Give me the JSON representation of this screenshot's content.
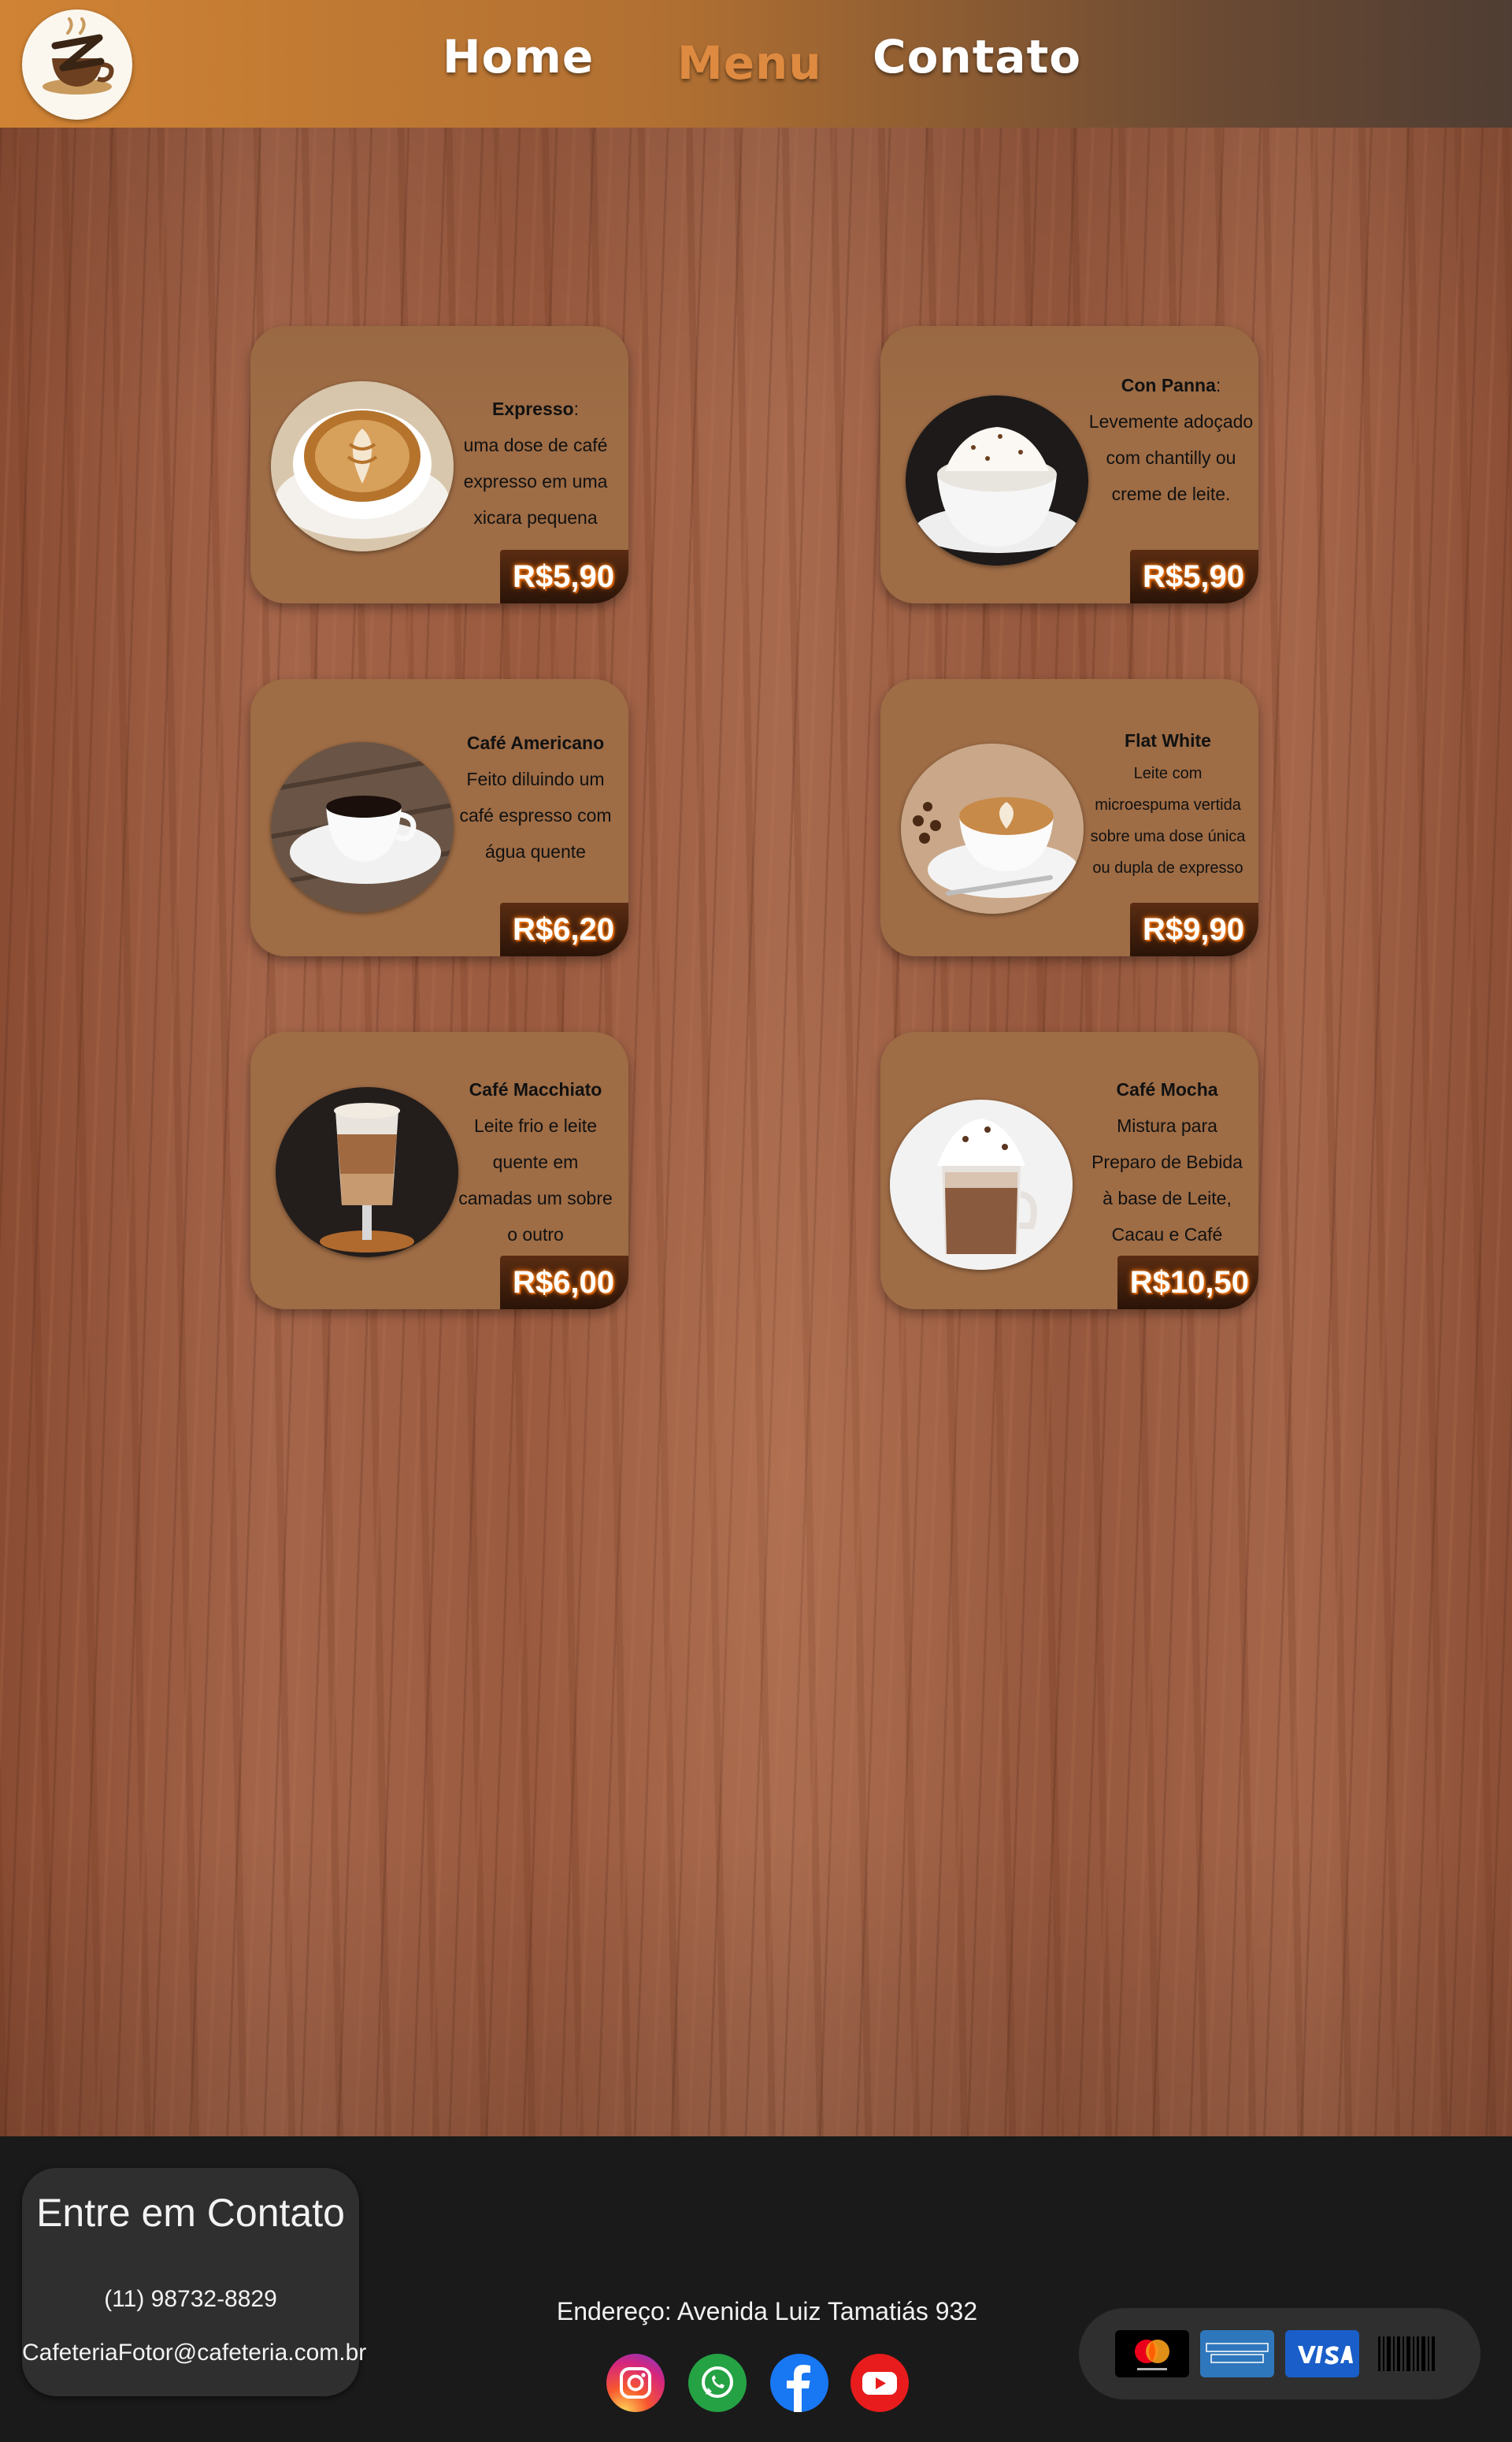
{
  "header": {
    "logo_icon": "coffee-cup-logo-icon",
    "nav": [
      {
        "label": "Home"
      },
      {
        "label": "Menu",
        "active": true
      },
      {
        "label": "Contato"
      }
    ],
    "colors": {
      "active_nav": "#de8a40",
      "nav": "#ffffff"
    }
  },
  "menu": {
    "items": [
      {
        "name": "Expresso",
        "suffix": ":",
        "description": "uma dose de café expresso em uma xicara pequena",
        "price": "R$5,90",
        "image": "latte-art-cup-photo"
      },
      {
        "name": "Con Panna",
        "suffix": ":",
        "description": "Levemente adoçado com chantilly ou creme de leite.",
        "price": "R$5,90",
        "image": "whipped-cream-coffee-photo"
      },
      {
        "name": "Café Americano",
        "suffix": "",
        "description": "Feito diluindo um café espresso com água quente",
        "price": "R$6,20",
        "image": "black-coffee-cup-photo"
      },
      {
        "name": "Flat White",
        "suffix": "",
        "description": "Leite com microespuma vertida sobre uma dose única ou dupla de expresso",
        "price": "R$9,90",
        "image": "flat-white-cup-photo"
      },
      {
        "name": "Café Macchiato",
        "suffix": "",
        "description": "Leite frio e leite quente em camadas um sobre o outro",
        "price": "R$6,00",
        "image": "macchiato-glass-photo"
      },
      {
        "name": "Café Mocha",
        "suffix": "",
        "description": "Mistura para Preparo de Bebida à base de Leite, Cacau e Café",
        "price": "R$10,50",
        "image": "mocha-glass-photo"
      }
    ],
    "colors": {
      "card": "#9e6c45",
      "price_glow": "#ff8a1e"
    }
  },
  "footer": {
    "contact": {
      "title": "Entre em Contato",
      "phone": "(11) 98732-8829",
      "email": "CafeteriaFotor@cafeteria.com.br"
    },
    "address": "Endereço: Avenida Luiz Tamatiás 932",
    "socials": [
      "instagram-icon",
      "whatsapp-icon",
      "facebook-icon",
      "youtube-icon"
    ],
    "payments": [
      "mastercard-icon",
      "american-express-icon",
      "visa-icon",
      "boleto-icon"
    ]
  }
}
